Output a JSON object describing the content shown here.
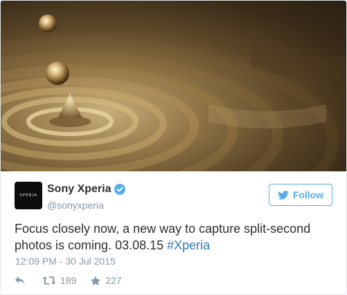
{
  "tweet": {
    "author_name": "Sony Xperia",
    "handle": "@sonyxperia",
    "avatar_text": "XPERIA",
    "follow_label": "Follow",
    "text_main": "Focus closely now, a new way to capture split-second photos is coming. 03.08.15 ",
    "hashtag": "#Xperia",
    "timestamp": "12:09 PM - 30 Jul 2015",
    "retweet_count": "189",
    "favorite_count": "227"
  },
  "colors": {
    "accent": "#55acee",
    "link": "#2b7bb9",
    "muted": "#8899a6",
    "text": "#292f33"
  },
  "icons": [
    "verified-icon",
    "twitter-bird-icon",
    "reply-icon",
    "retweet-icon",
    "favorite-star-icon"
  ]
}
